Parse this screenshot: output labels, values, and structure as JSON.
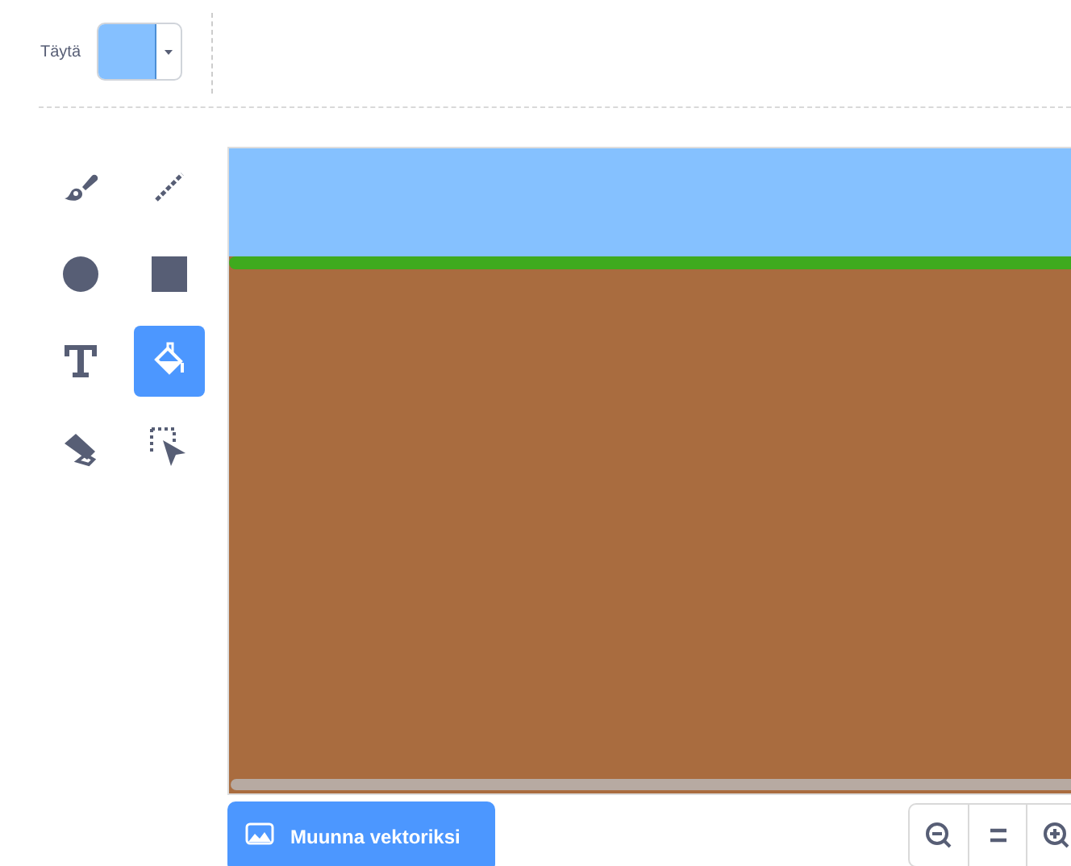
{
  "fill": {
    "label": "Täytä",
    "color": "#85c0ff"
  },
  "tools": [
    {
      "kind": "brush",
      "selected": false
    },
    {
      "kind": "line",
      "selected": false
    },
    {
      "kind": "circle",
      "selected": false
    },
    {
      "kind": "rectangle",
      "selected": false
    },
    {
      "kind": "text",
      "selected": false
    },
    {
      "kind": "fill",
      "selected": true
    },
    {
      "kind": "eraser",
      "selected": false
    },
    {
      "kind": "select",
      "selected": false
    }
  ],
  "convert_button": {
    "label": "Muunna vektoriksi"
  },
  "zoom_controls": [
    {
      "kind": "zoom-out"
    },
    {
      "kind": "reset"
    },
    {
      "kind": "zoom-in"
    }
  ]
}
